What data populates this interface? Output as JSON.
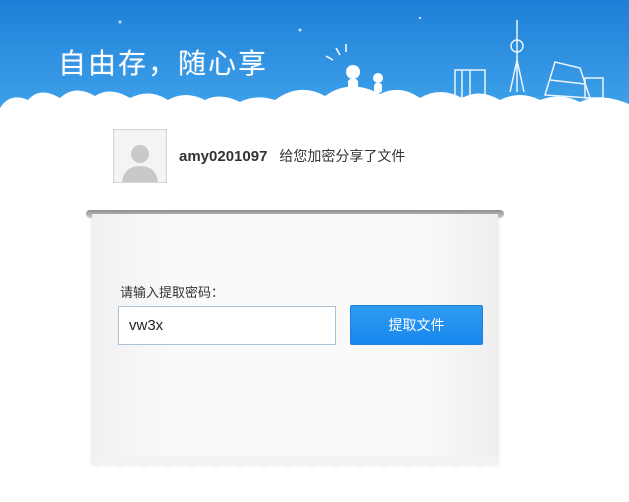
{
  "banner": {
    "slogan": "自由存，随心享"
  },
  "share": {
    "username": "amy0201097",
    "message": "给您加密分享了文件"
  },
  "form": {
    "label": "请输入提取密码：",
    "code_value": "vw3x",
    "submit_label": "提取文件"
  },
  "colors": {
    "banner_blue": "#2b8ee0",
    "button_blue": "#1a8aee"
  }
}
